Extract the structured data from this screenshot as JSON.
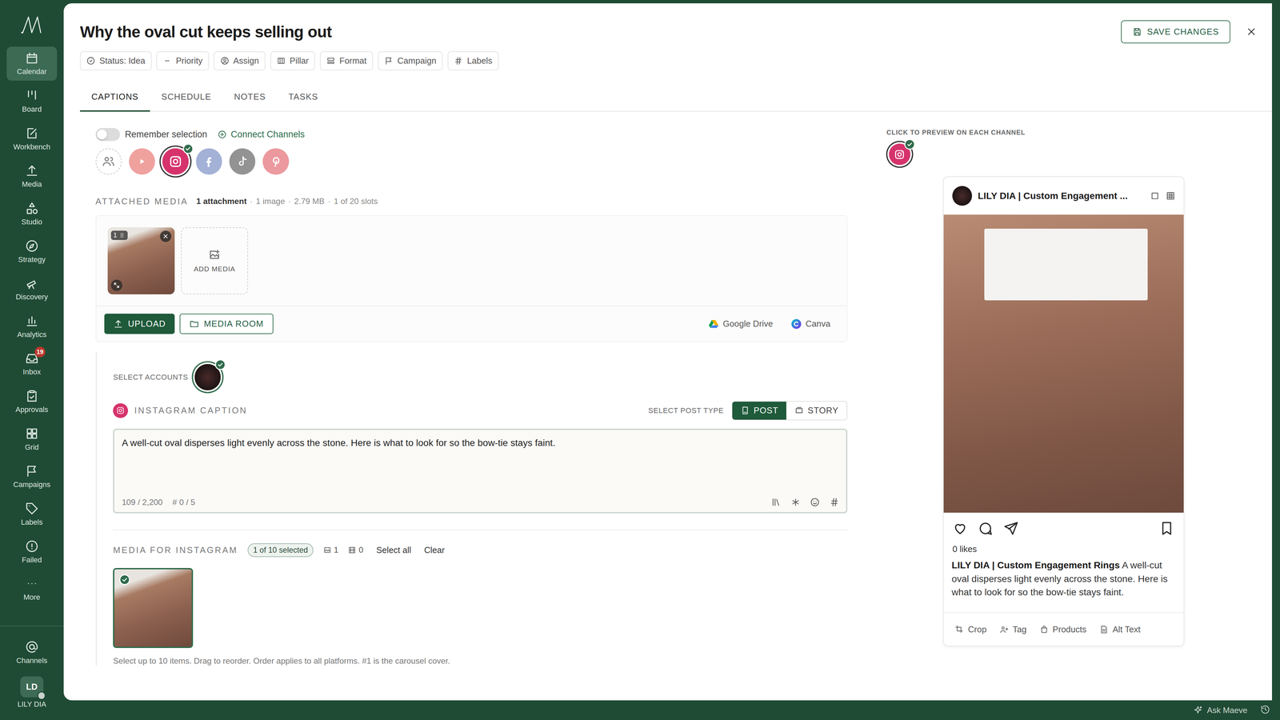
{
  "sidebar": {
    "items": [
      {
        "label": "Calendar",
        "selected": true
      },
      {
        "label": "Board",
        "selected": false
      },
      {
        "label": "Workbench",
        "selected": false
      },
      {
        "label": "Media",
        "selected": false
      },
      {
        "label": "Studio",
        "selected": false
      },
      {
        "label": "Strategy",
        "selected": false
      },
      {
        "label": "Discovery",
        "selected": false
      },
      {
        "label": "Analytics",
        "selected": false
      },
      {
        "label": "Inbox",
        "selected": false,
        "badge": "19"
      },
      {
        "label": "Approvals",
        "selected": false
      },
      {
        "label": "Grid",
        "selected": false
      },
      {
        "label": "Campaigns",
        "selected": false
      },
      {
        "label": "Labels",
        "selected": false
      },
      {
        "label": "Failed",
        "selected": false
      },
      {
        "label": "More",
        "selected": false
      }
    ],
    "channels": {
      "label": "Channels"
    },
    "user": {
      "initials": "LD",
      "name": "LILY DIA"
    }
  },
  "header": {
    "title": "Why the oval cut keeps selling out",
    "save": "SAVE CHANGES"
  },
  "chips": [
    "Status: Idea",
    "Priority",
    "Assign",
    "Pillar",
    "Format",
    "Campaign",
    "Labels"
  ],
  "tabs": [
    {
      "label": "CAPTIONS",
      "selected": true
    },
    {
      "label": "SCHEDULE",
      "selected": false
    },
    {
      "label": "NOTES",
      "selected": false
    },
    {
      "label": "TASKS",
      "selected": false
    }
  ],
  "channel_picker": {
    "remember": {
      "label": "Remember selection",
      "on": false
    },
    "connect": "Connect Channels",
    "channels": [
      {
        "kind": "accounts",
        "selected": false,
        "color": "#ffffff"
      },
      {
        "kind": "youtube",
        "selected": false,
        "color": "#e0453f"
      },
      {
        "kind": "instagram",
        "selected": true,
        "color": "#d6336c"
      },
      {
        "kind": "facebook",
        "selected": false,
        "color": "#4a66b0"
      },
      {
        "kind": "tiktok",
        "selected": false,
        "color": "#2a2a2a"
      },
      {
        "kind": "pinterest",
        "selected": false,
        "color": "#d8363f"
      }
    ]
  },
  "attached_media": {
    "label": "ATTACHED MEDIA",
    "count": "1 attachment",
    "details": [
      "1 image",
      "2.79 MB",
      "1 of 20 slots"
    ],
    "separator": "·",
    "items": [
      {
        "index": "1"
      }
    ],
    "add": "ADD MEDIA",
    "upload": "UPLOAD",
    "media_room": "MEDIA ROOM",
    "sources": [
      "Google Drive",
      "Canva"
    ]
  },
  "accounts": {
    "label": "SELECT ACCOUNTS",
    "items": [
      {
        "selected": true
      }
    ]
  },
  "caption": {
    "label": "INSTAGRAM CAPTION",
    "post_type_label": "SELECT POST TYPE",
    "post_types": [
      {
        "label": "POST",
        "selected": true
      },
      {
        "label": "STORY",
        "selected": false
      }
    ],
    "text": "A well-cut oval disperses light evenly across the stone. Here is what to look for so the bow-tie stays faint.",
    "count": "109 / 2,200",
    "hashtags": "# 0 / 5"
  },
  "media_for": {
    "label": "MEDIA FOR INSTAGRAM",
    "selected_count": "1 of 10 selected",
    "images": "1",
    "videos": "0",
    "select_all": "Select all",
    "clear": "Clear",
    "items": [
      {
        "selected": true
      }
    ],
    "hint": "Select up to 10 items. Drag to reorder. Order applies to all platforms. #1 is the carousel cover."
  },
  "preview": {
    "label": "CLICK TO PREVIEW ON EACH CHANNEL",
    "channels": [
      {
        "kind": "instagram",
        "selected": true,
        "color": "#d6336c"
      }
    ],
    "account": "LILY DIA | Custom Engagement ...",
    "likes": "0 likes",
    "caption_account": "LILY DIA | Custom Engagement Rings",
    "caption": "A well-cut oval disperses light evenly across the stone. Here is what to look for so the bow-tie stays faint.",
    "tools": [
      "Crop",
      "Tag",
      "Products",
      "Alt Text"
    ]
  },
  "footer": {
    "assistant": "Ask Maeve"
  }
}
